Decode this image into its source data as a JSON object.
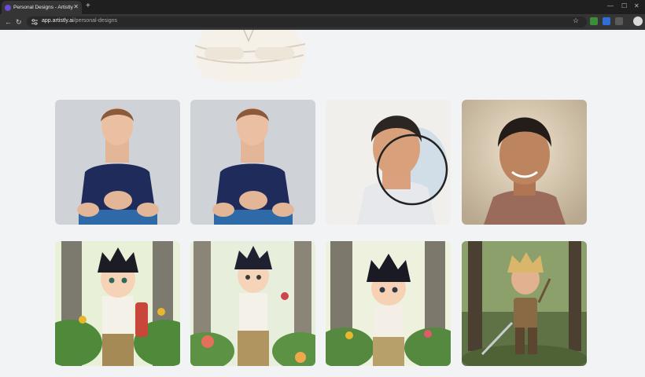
{
  "browser": {
    "tab_title": "Personal Designs - Artistly",
    "new_tab_symbol": "+",
    "close_symbol": "✕",
    "url_host": "app.artistly.ai",
    "url_path": "/personal-designs"
  },
  "icons": [
    "back-icon",
    "forward-icon",
    "reload-icon",
    "site-info-icon",
    "star-icon",
    "extension-icon",
    "profile-icon",
    "close-icon",
    "minimize-icon",
    "maximize-icon"
  ],
  "gallery": {
    "rows": [
      {
        "items": [
          {
            "name": "young man navy t-shirt photo",
            "style": "photo"
          },
          {
            "name": "young man navy t-shirt photo duplicate",
            "style": "photo"
          },
          {
            "name": "man watercolor portrait",
            "style": "watercolor"
          },
          {
            "name": "man painted portrait",
            "style": "painting"
          }
        ]
      },
      {
        "items": [
          {
            "name": "cartoon boy forest with backpack",
            "style": "cartoon"
          },
          {
            "name": "cartoon boy forest flowers",
            "style": "cartoon"
          },
          {
            "name": "cartoon boy forest trees",
            "style": "cartoon"
          },
          {
            "name": "3d warrior boy with sword",
            "style": "3d"
          }
        ]
      }
    ]
  },
  "colors": {
    "chrome_dark": "#1f1f1f",
    "toolbar": "#353535",
    "page_bg": "#f2f3f5",
    "accent": "#6d4cd6"
  }
}
